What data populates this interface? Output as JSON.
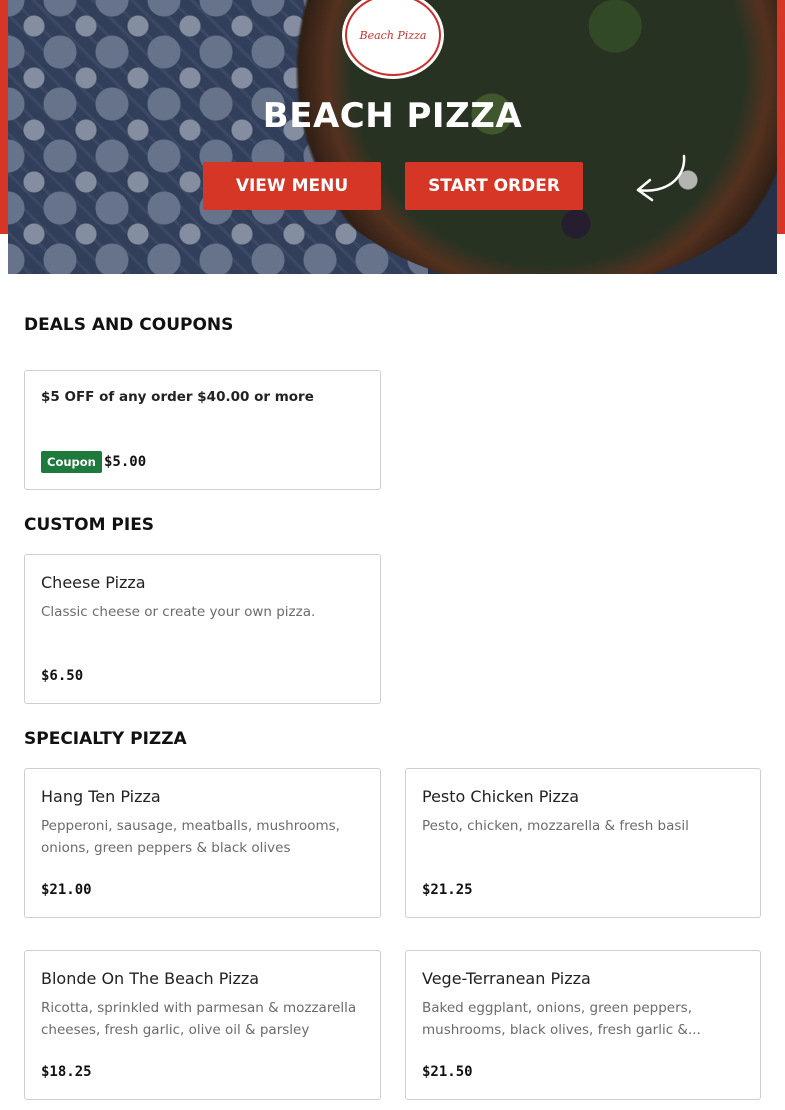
{
  "hero": {
    "logo_text": "Beach Pizza",
    "title": "BEACH PIZZA",
    "view_menu_label": "VIEW MENU",
    "start_order_label": "START ORDER"
  },
  "deals": {
    "heading": "DEALS AND COUPONS",
    "items": [
      {
        "text": "$5 OFF of any order $40.00 or more",
        "badge": "Coupon",
        "price": "$5.00"
      }
    ]
  },
  "custom_pies": {
    "heading": "CUSTOM PIES",
    "items": [
      {
        "name": "Cheese Pizza",
        "description": "Classic cheese or create your own pizza.",
        "price": "$6.50"
      }
    ]
  },
  "specialty": {
    "heading": "SPECIALTY PIZZA",
    "items": [
      {
        "name": "Hang Ten Pizza",
        "description": "Pepperoni, sausage, meatballs, mushrooms, onions, green peppers & black olives",
        "price": "$21.00"
      },
      {
        "name": "Pesto Chicken Pizza",
        "description": "Pesto, chicken, mozzarella & fresh basil",
        "price": "$21.25"
      },
      {
        "name": "Blonde On The Beach Pizza",
        "description": "Ricotta, sprinkled with parmesan & mozzarella cheeses, fresh garlic, olive oil & parsley",
        "price": "$18.25"
      },
      {
        "name": "Vege-Terranean Pizza",
        "description": "Baked eggplant, onions, green peppers, mushrooms, black olives, fresh garlic &...",
        "price": "$21.50"
      }
    ]
  },
  "colors": {
    "accent": "#d63626",
    "coupon_badge": "#1e7a3c"
  }
}
